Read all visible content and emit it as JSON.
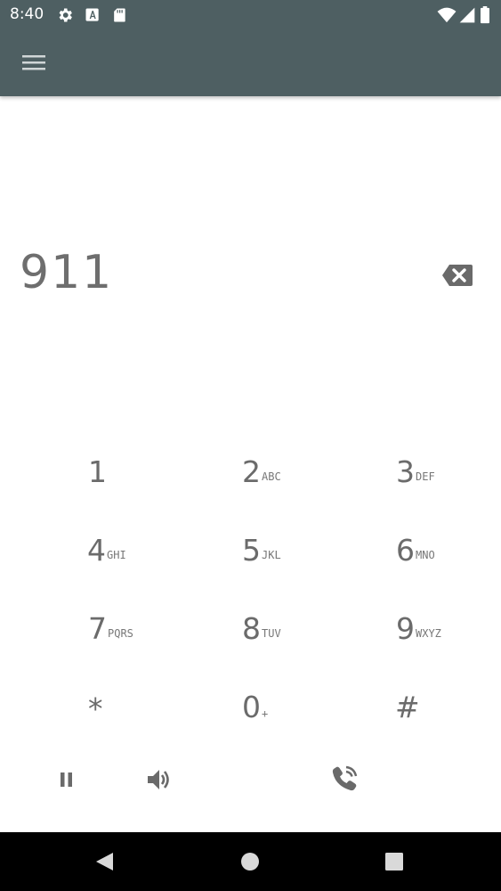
{
  "status_bar": {
    "time": "8:40",
    "icons": [
      "settings-icon",
      "a-badge-icon",
      "sd-card-icon",
      "wifi-icon",
      "signal-icon",
      "battery-icon"
    ]
  },
  "app_bar": {
    "menu_icon": "hamburger-menu-icon"
  },
  "dialer": {
    "entered_number": "911",
    "backspace_icon": "backspace-icon"
  },
  "keypad": {
    "keys": [
      {
        "digit": "1",
        "letters": ""
      },
      {
        "digit": "2",
        "letters": "ABC"
      },
      {
        "digit": "3",
        "letters": "DEF"
      },
      {
        "digit": "4",
        "letters": "GHI"
      },
      {
        "digit": "5",
        "letters": "JKL"
      },
      {
        "digit": "6",
        "letters": "MNO"
      },
      {
        "digit": "7",
        "letters": "PQRS"
      },
      {
        "digit": "8",
        "letters": "TUV"
      },
      {
        "digit": "9",
        "letters": "WXYZ"
      },
      {
        "digit": "*",
        "letters": ""
      },
      {
        "digit": "0",
        "letters": "+"
      },
      {
        "digit": "#",
        "letters": ""
      }
    ]
  },
  "actions": {
    "icons": [
      "pause-icon",
      "speaker-icon",
      "call-icon"
    ]
  },
  "nav_bar": {
    "icons": [
      "back-icon",
      "home-icon",
      "recents-icon"
    ]
  },
  "colors": {
    "app_bar": "#4e5f62",
    "digit_text": "#6b6b6b",
    "icon": "#6a6a6a",
    "nav_bar": "#000000"
  }
}
